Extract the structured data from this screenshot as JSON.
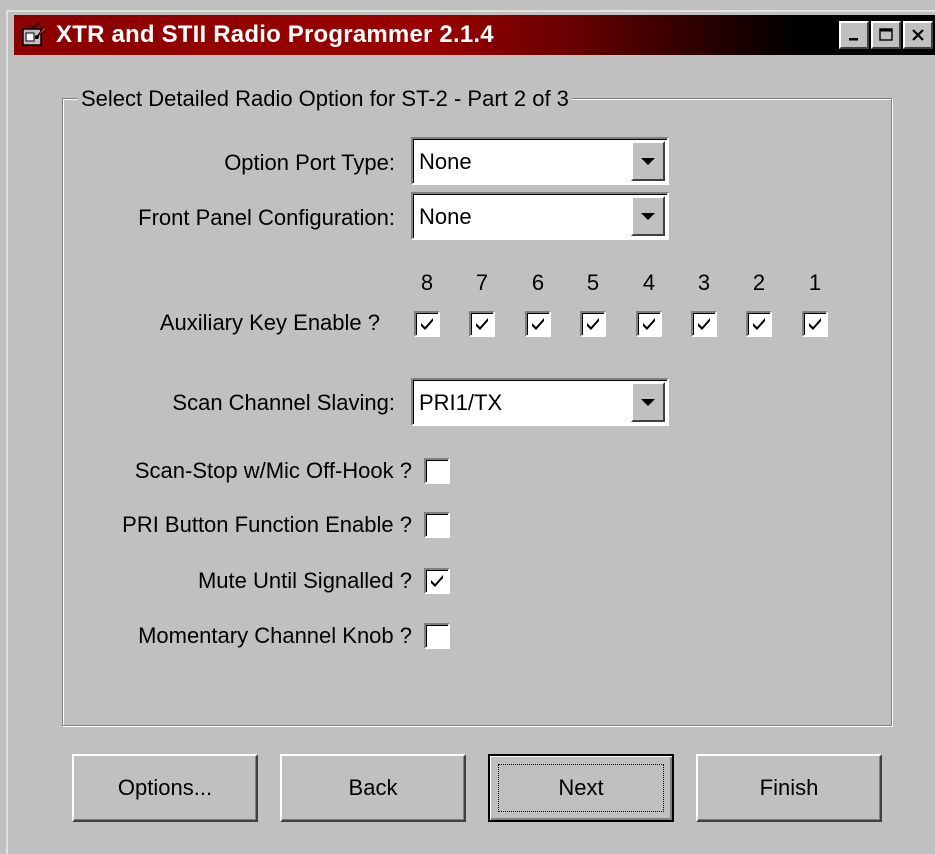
{
  "window": {
    "title": "XTR and STII Radio Programmer 2.1.4",
    "icon": "app-radio-icon",
    "caption_buttons": [
      "minimize-icon",
      "maximize-icon",
      "close-icon"
    ]
  },
  "group": {
    "title": "Select Detailed Radio Option for ST-2 - Part 2 of 3"
  },
  "option_port": {
    "label": "Option Port Type:",
    "value": "None"
  },
  "front_panel": {
    "label": "Front Panel Configuration:",
    "value": "None"
  },
  "aux_keys": {
    "label": "Auxiliary Key Enable ?",
    "keys": [
      {
        "num": "8",
        "checked": true
      },
      {
        "num": "7",
        "checked": true
      },
      {
        "num": "6",
        "checked": true
      },
      {
        "num": "5",
        "checked": true
      },
      {
        "num": "4",
        "checked": true
      },
      {
        "num": "3",
        "checked": true
      },
      {
        "num": "2",
        "checked": true
      },
      {
        "num": "1",
        "checked": true
      }
    ]
  },
  "scan_slaving": {
    "label": "Scan Channel Slaving:",
    "value": "PRI1/TX"
  },
  "options": [
    {
      "label": "Scan-Stop w/Mic Off-Hook ?",
      "checked": false
    },
    {
      "label": "PRI Button Function Enable ?",
      "checked": false
    },
    {
      "label": "Mute Until Signalled ?",
      "checked": true
    },
    {
      "label": "Momentary Channel Knob ?",
      "checked": false
    }
  ],
  "buttons": {
    "options": "Options...",
    "back": "Back",
    "next": "Next",
    "finish": "Finish"
  }
}
